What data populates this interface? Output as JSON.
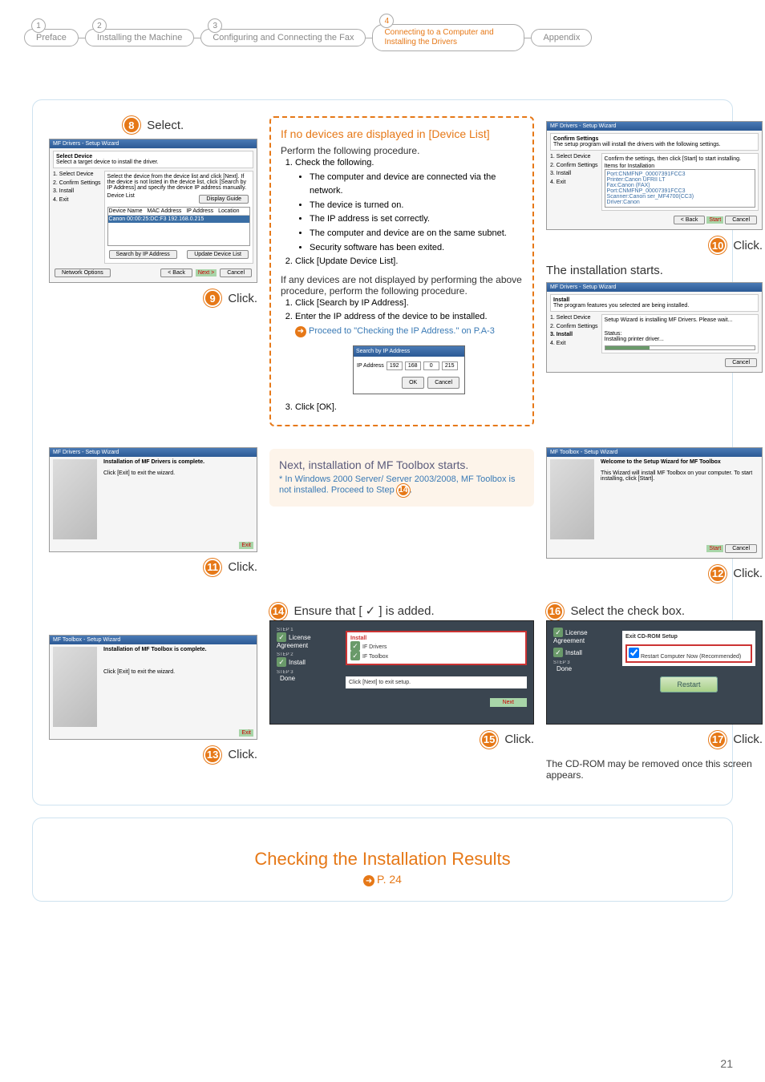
{
  "tabs": {
    "t1": {
      "num": "1",
      "label": "Preface"
    },
    "t2": {
      "num": "2",
      "label": "Installing the Machine"
    },
    "t3": {
      "num": "3",
      "label": "Configuring and Connecting the Fax"
    },
    "t4": {
      "num": "4",
      "label": "Connecting to a Computer and Installing the Drivers"
    },
    "t5": {
      "num": "",
      "label": "Appendix"
    }
  },
  "step8": {
    "num": "8",
    "label": "Select."
  },
  "step9": {
    "num": "9",
    "label": "Click."
  },
  "step10": {
    "num": "10",
    "label": "Click."
  },
  "step11": {
    "num": "11",
    "label": "Click."
  },
  "step12": {
    "num": "12",
    "label": "Click."
  },
  "step13": {
    "num": "13",
    "label": "Click."
  },
  "step14": {
    "num": "14",
    "label": "Ensure that [ ✓ ] is added."
  },
  "step15": {
    "num": "15",
    "label": "Click."
  },
  "step16": {
    "num": "16",
    "label": "Select the check box."
  },
  "step17": {
    "num": "17",
    "label": "Click."
  },
  "wiz8": {
    "title": "MF Drivers - Setup Wizard",
    "heading": "Select Device",
    "sub": "Select a target device to install the driver.",
    "steps": [
      "1. Select Device",
      "2. Confirm Settings",
      "3. Install",
      "4. Exit"
    ],
    "instr": "Select the device from the device list and click [Next]. If the device is not listed in the device list, click [Search by IP Address] and specify the device IP address manually.",
    "listLabel": "Device List",
    "displayBtn": "Display Guide",
    "cols": [
      "Device Name",
      "MAC Address",
      "IP Address",
      "Location"
    ],
    "row": "Canon                00:00:25:DC:F3      192.168.0.215",
    "searchBtn": "Search by IP Address",
    "updateBtn": "Update Device List",
    "networkBtn": "Network Options",
    "back": "< Back",
    "next": "Next >",
    "cancel": "Cancel"
  },
  "callout": {
    "title": "If no devices are displayed in [Device List]",
    "perform": "Perform the following procedure.",
    "s1": "Check the following.",
    "b1": "The computer and device are connected via the network.",
    "b2": "The device is turned on.",
    "b3": "The IP address is set correctly.",
    "b4": "The computer and device are on the same subnet.",
    "b5": "Security software has been exited.",
    "s2": "Click [Update Device List].",
    "mid": "If any devices are not displayed by performing the above procedure, perform the following procedure.",
    "p1": "Click [Search by IP Address].",
    "p2": "Enter the IP address of the device to be installed.",
    "proceed": "Proceed to \"Checking the IP Address.\" on P.A-3",
    "p3": "Click [OK].",
    "ipTitle": "Search by IP Address",
    "ipLabel": "IP Address",
    "ip": [
      "192",
      "168",
      "0",
      "215"
    ],
    "ok": "OK",
    "ipCancel": "Cancel"
  },
  "wiz10": {
    "title": "MF Drivers - Setup Wizard",
    "heading": "Confirm Settings",
    "sub": "The setup program will install the drivers with the following settings.",
    "steps": [
      "1. Select Device",
      "2. Confirm Settings",
      "3. Install",
      "4. Exit"
    ],
    "instr": "Confirm the settings, then click [Start] to start installing.",
    "items": "Items for Installation",
    "lines": [
      "Port:CNMFNP_00007391FCC3",
      "Printer:Canon                        UFRII LT",
      "Fax:Canon                          (FAX)",
      "Port:CNMFNP_00007391FCC3",
      "Scanner:Canon                  ser_MF4700(CC3)",
      "Driver:Canon"
    ],
    "back": "< Back",
    "start": "Start",
    "cancel": "Cancel"
  },
  "installStarts": "The installation starts.",
  "wizInstall": {
    "title": "MF Drivers - Setup Wizard",
    "heading": "Install",
    "sub": "The program features you selected are being installed.",
    "msg": "Setup Wizard is installing MF Drivers. Please wait...",
    "status": "Status:",
    "statusLine": "Installing printer driver...",
    "cancel": "Cancel"
  },
  "wiz11": {
    "title": "MF Drivers - Setup Wizard",
    "heading": "Installation of MF Drivers is complete.",
    "sub": "Click [Exit] to exit the wizard.",
    "exit": "Exit"
  },
  "toolbox": {
    "heading": "Next, installation of MF Toolbox starts.",
    "note": "* In Windows 2000 Server/ Server 2003/2008, MF Toolbox is not installed. Proceed to Step",
    "stepRef": "14"
  },
  "wiz12": {
    "title": "MF Toolbox - Setup Wizard",
    "heading": "Welcome to the Setup Wizard for MF Toolbox",
    "sub": "This Wizard will install MF Toolbox on your computer. To start installing, click [Start].",
    "start": "Start",
    "cancel": "Cancel"
  },
  "wiz13": {
    "title": "MF Toolbox - Setup Wizard",
    "heading": "Installation of MF Toolbox is complete.",
    "sub": "Click [Exit] to exit the wizard.",
    "exit": "Exit"
  },
  "panel14": {
    "step1": "STEP 1",
    "step1l": "License Agreement",
    "step2": "STEP 2",
    "step2l": "Install",
    "step3": "STEP 3",
    "step3l": "Done",
    "listHead": "Install",
    "items": [
      "IF Drivers",
      "IF Toolbox"
    ],
    "hint": "Click [Next] to exit setup.",
    "next": "Next"
  },
  "panel16": {
    "exitLabel": "Exit CD-ROM Setup",
    "checkbox": "Restart Computer Now (Recommended)",
    "restart": "Restart"
  },
  "cdNote": "The CD-ROM may be removed once this screen appears.",
  "footer": {
    "title": "Checking the Installation Results",
    "pref": "P. 24"
  },
  "pageNum": "21"
}
